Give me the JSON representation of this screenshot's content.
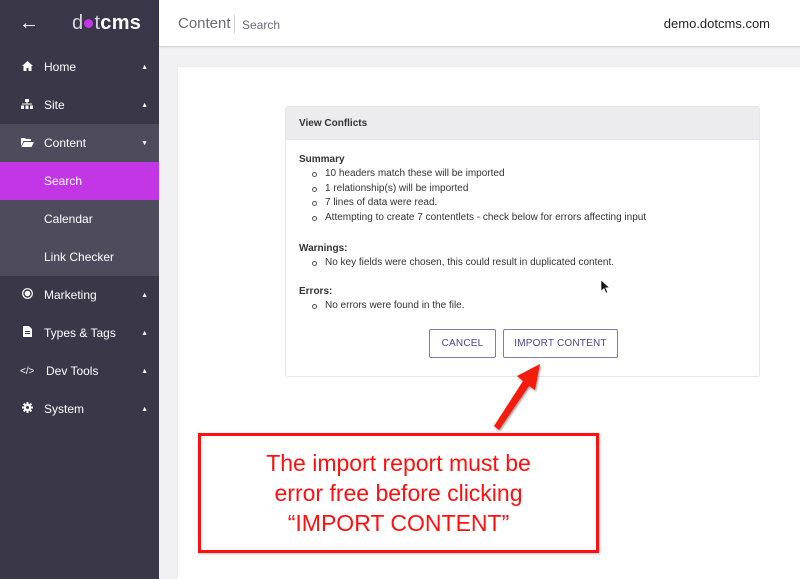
{
  "app": {
    "logo_light": "d",
    "logo_light2": "t",
    "logo_bold": "cms",
    "back_icon": "arrow-left-icon"
  },
  "sidebar": {
    "items": [
      {
        "label": "Home",
        "icon": "home-icon",
        "caret": "▲"
      },
      {
        "label": "Site",
        "icon": "sitemap-icon",
        "caret": "▲"
      },
      {
        "label": "Content",
        "icon": "folder-open-icon",
        "caret": "▼",
        "expanded": true,
        "children": [
          {
            "label": "Search",
            "active": true
          },
          {
            "label": "Calendar"
          },
          {
            "label": "Link Checker"
          }
        ]
      },
      {
        "label": "Marketing",
        "icon": "bullseye-icon",
        "caret": "▲"
      },
      {
        "label": "Types & Tags",
        "icon": "file-icon",
        "caret": "▲"
      },
      {
        "label": "Dev Tools",
        "icon": "code-icon",
        "caret": "▲"
      },
      {
        "label": "System",
        "icon": "gear-icon",
        "caret": "▲"
      }
    ]
  },
  "header": {
    "breadcrumb_main": "Content",
    "breadcrumb_sub": "Search",
    "site": "demo.dotcms.com"
  },
  "dialog": {
    "title": "View Conflicts",
    "summary_title": "Summary",
    "summary_items": [
      "10 headers match these will be imported",
      "1 relationship(s) will be imported",
      "7 lines of data were read.",
      "Attempting to create 7 contentlets - check below for errors affecting input"
    ],
    "warnings_title": "Warnings:",
    "warnings_items": [
      "No key fields were chosen, this could result in duplicated content."
    ],
    "errors_title": "Errors:",
    "errors_items": [
      "No errors were found in the file."
    ],
    "cancel_label": "CANCEL",
    "import_label": "IMPORT CONTENT"
  },
  "annotation": {
    "lines": [
      "The import report must be",
      "error free before clicking",
      "“IMPORT CONTENT”"
    ],
    "color": "#ff1010"
  },
  "colors": {
    "accent": "#c336e5",
    "sidebar_bg": "#3a3748",
    "sidebar_open_bg": "#4e4b5c",
    "button_text": "#4b4590"
  }
}
